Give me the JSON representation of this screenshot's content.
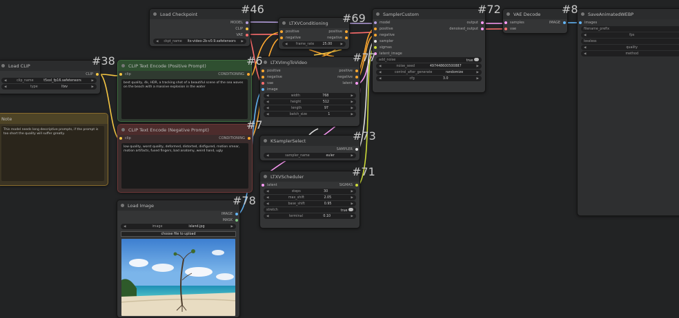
{
  "colors": {
    "model": "#b39ddb",
    "clip": "#f6c744",
    "vae": "#ff6e6e",
    "conditioning": "#ffa931",
    "latent": "#ff9cf9",
    "image": "#64b5f6",
    "sampler": "#e0e0e0",
    "sigmas": "#cddc39",
    "mask": "#81c784"
  },
  "nodes": {
    "load_checkpoint": {
      "id": "#46",
      "title": "Load Checkpoint",
      "outputs": [
        "MODEL",
        "CLIP",
        "VAE"
      ],
      "ckpt_label": "ckpt_name",
      "ckpt_value": "ltx-video-2b-v0.9.safetensors"
    },
    "ltxv_conditioning": {
      "id": "#69",
      "title": "LTXVConditioning",
      "inputs": [
        "positive",
        "negative"
      ],
      "outputs": [
        "positive",
        "negative"
      ],
      "frame_rate_label": "frame_rate",
      "frame_rate_value": "25.00"
    },
    "sampler_custom": {
      "id": "#72",
      "title": "SamplerCustom",
      "inputs": [
        "model",
        "positive",
        "negative",
        "sampler",
        "sigmas",
        "latent_image"
      ],
      "outputs": [
        "output",
        "denoised_output"
      ],
      "widgets": [
        {
          "label": "add_noise",
          "value": "true"
        },
        {
          "label": "noise_seed",
          "value": "497448600500887"
        },
        {
          "label": "control_after_generate",
          "value": "randomize"
        },
        {
          "label": "cfg",
          "value": "3.0"
        }
      ]
    },
    "vae_decode": {
      "id": "#8",
      "title": "VAE Decode",
      "inputs": [
        "samples",
        "vae"
      ],
      "outputs": [
        "IMAGE"
      ]
    },
    "save_animated": {
      "title": "SaveAnimatedWEBP",
      "inputs": [
        "images"
      ],
      "widgets": [
        "filename_prefix",
        "fps",
        "lossless",
        "quality",
        "method"
      ]
    },
    "load_clip": {
      "id": "#38",
      "title": "Load CLIP",
      "outputs": [
        "CLIP"
      ],
      "widgets": [
        {
          "label": "clip_name",
          "value": "t5xxl_fp16.safetensors"
        },
        {
          "label": "type",
          "value": "ltxv"
        }
      ]
    },
    "clip_pos": {
      "id": "#6",
      "title": "CLIP Text Encode (Positive Prompt)",
      "input": "clip",
      "output": "CONDITIONING",
      "text": "best quality, 4k, HDR, a tracking shot of a beautiful scene of the sea waves on the beach with a massive explosion in the water"
    },
    "note": {
      "title": "Note",
      "text": "This model needs long descriptive prompts, if the prompt is too short the quality will suffer greatly."
    },
    "clip_neg": {
      "id": "#7",
      "title": "CLIP Text Encode (Negative Prompt)",
      "input": "clip",
      "output": "CONDITIONING",
      "text": "low quality, worst quality, deformed, distorted, disfigured, motion smear, motion artifacts, fused fingers, bad anatomy, weird hand, ugly"
    },
    "ltxv_img_to_video": {
      "id": "#77",
      "title": "LTXVImgToVideo",
      "inputs": [
        "positive",
        "negative",
        "vae",
        "image"
      ],
      "outputs": [
        "positive",
        "negative",
        "latent"
      ],
      "widgets": [
        {
          "label": "width",
          "value": "768"
        },
        {
          "label": "height",
          "value": "512"
        },
        {
          "label": "length",
          "value": "97"
        },
        {
          "label": "batch_size",
          "value": "1"
        }
      ]
    },
    "ksampler_select": {
      "id": "#73",
      "title": "KSamplerSelect",
      "output": "SAMPLER",
      "widget": {
        "label": "sampler_name",
        "value": "euler"
      }
    },
    "ltxv_scheduler": {
      "id": "#71",
      "title": "LTXVScheduler",
      "input": "latent",
      "output": "SIGMAS",
      "widgets": [
        {
          "label": "steps",
          "value": "30"
        },
        {
          "label": "max_shift",
          "value": "2.05"
        },
        {
          "label": "base_shift",
          "value": "0.95"
        },
        {
          "label": "stretch",
          "value": "true"
        },
        {
          "label": "terminal",
          "value": "0.10"
        }
      ]
    },
    "load_image": {
      "id": "#78",
      "title": "Load Image",
      "outputs": [
        "IMAGE",
        "MASK"
      ],
      "widget": {
        "label": "image",
        "value": "island.jpg"
      },
      "upload_label": "choose file to upload"
    }
  }
}
